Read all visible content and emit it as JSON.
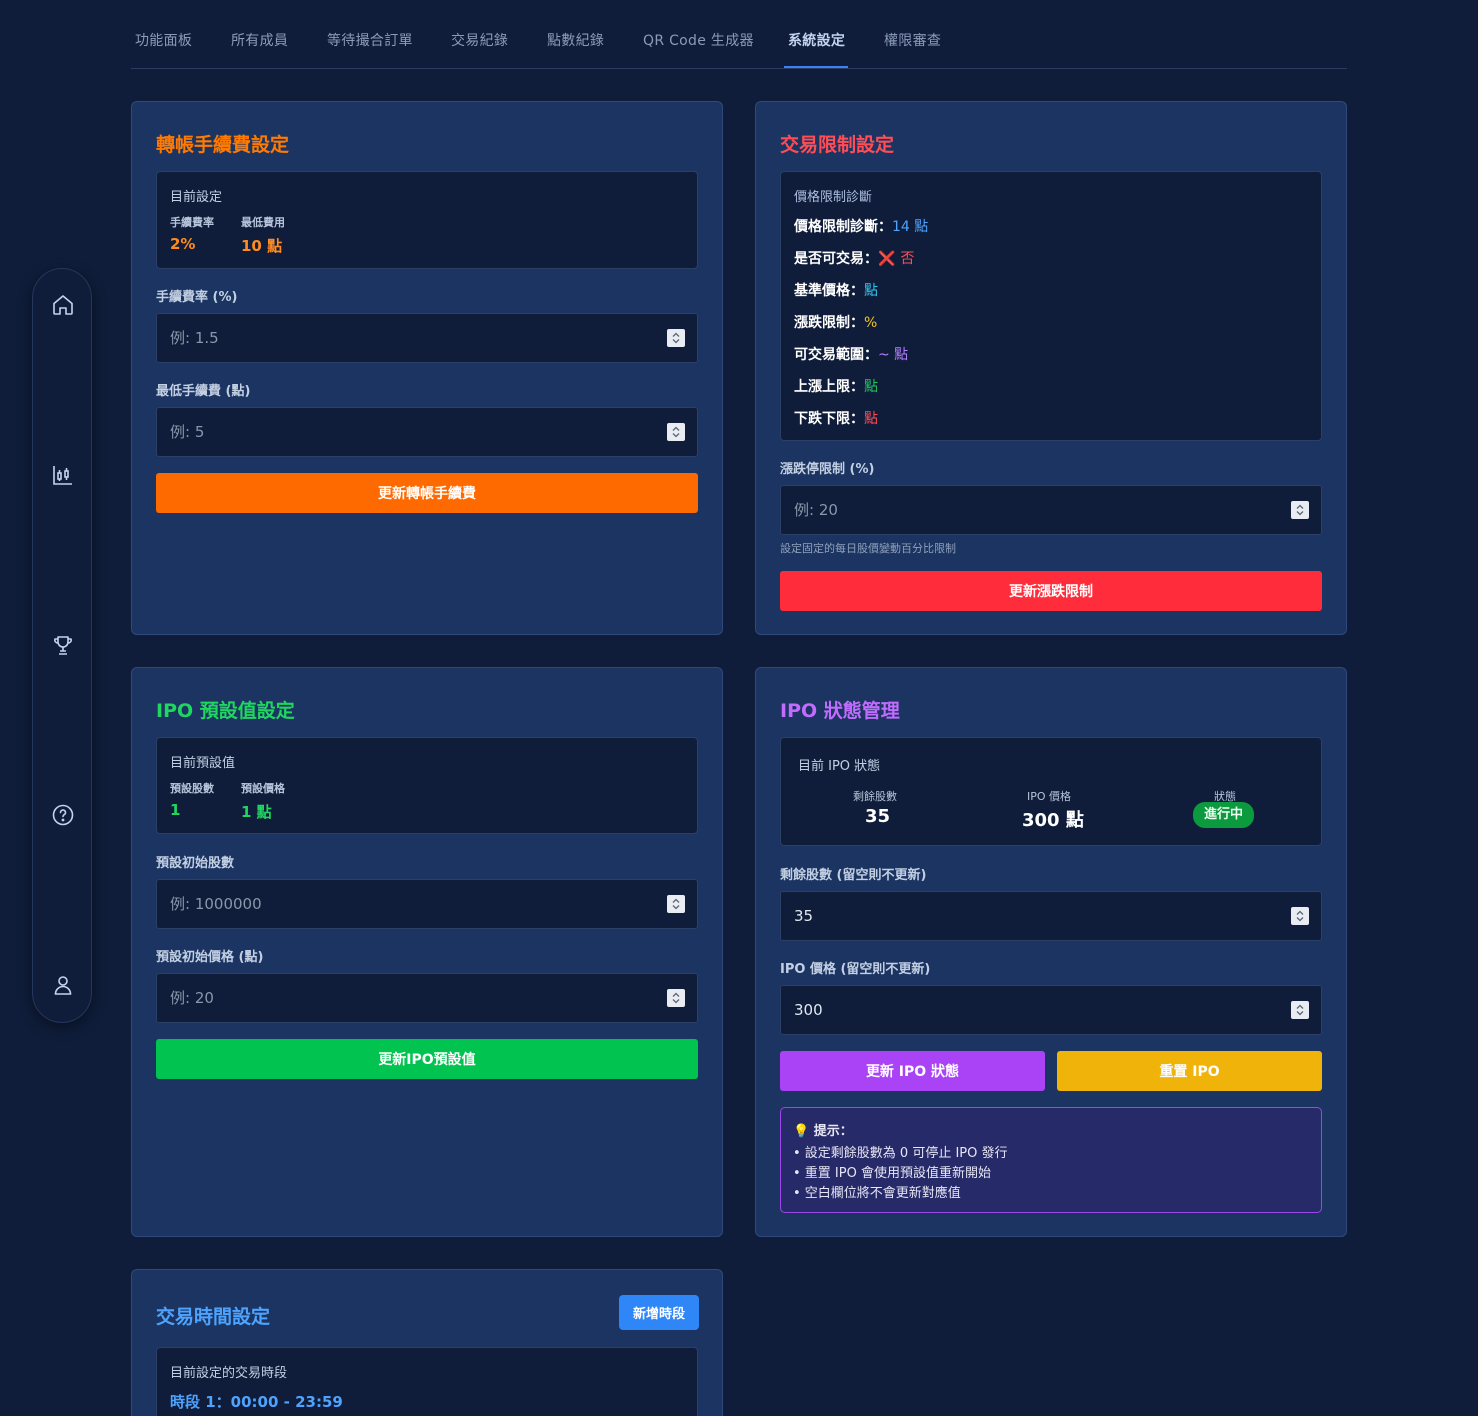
{
  "nav": {
    "tabs": [
      {
        "label": "功能面板"
      },
      {
        "label": "所有成員"
      },
      {
        "label": "等待撮合訂單"
      },
      {
        "label": "交易紀錄"
      },
      {
        "label": "點數紀錄"
      },
      {
        "label": "QR Code 生成器"
      },
      {
        "label": "系統設定"
      },
      {
        "label": "權限審查"
      }
    ],
    "active_tab": "系統設定"
  },
  "sidebar": {
    "icons": [
      "home-icon",
      "chart-icon",
      "trophy-icon",
      "help-icon",
      "user-icon"
    ]
  },
  "colors": {
    "accent_blue": "#3b82f6",
    "fee_orange": "#ff6a00",
    "limit_red": "#ff2d3b",
    "ipo_green": "#00c44f",
    "ipo_purple": "#a943f5",
    "reset_yellow": "#efb30a"
  },
  "fee": {
    "title": "轉帳手續費設定",
    "current_label": "目前設定",
    "rate_label": "手續費率",
    "rate_value": "2%",
    "min_label": "最低費用",
    "min_value": "10 點",
    "rate_field_label": "手續費率 (%)",
    "rate_placeholder": "例: 1.5",
    "min_field_label": "最低手續費 (點)",
    "min_placeholder": "例: 5",
    "button": "更新轉帳手續費"
  },
  "limit": {
    "title": "交易限制設定",
    "diag_title": "價格限制診斷",
    "rows": [
      {
        "label": "價格限制診斷：",
        "value": "14 點"
      },
      {
        "label": "是否可交易：",
        "value": "否"
      },
      {
        "label": "基準價格：",
        "value": "點"
      },
      {
        "label": "漲跌限制：",
        "value": "%"
      },
      {
        "label": "可交易範圍：",
        "value": "~ 點"
      },
      {
        "label": "上漲上限：",
        "value": "點"
      },
      {
        "label": "下跌下限：",
        "value": "點"
      }
    ],
    "field_label": "漲跌停限制 (%)",
    "placeholder": "例: 20",
    "helper": "設定固定的每日股價變動百分比限制",
    "button": "更新漲跌限制"
  },
  "ipo_defaults": {
    "title": "IPO 預設值設定",
    "current_label": "目前預設值",
    "shares_label": "預設股數",
    "shares_value": "1",
    "price_label": "預設價格",
    "price_value": "1 點",
    "shares_field_label": "預設初始股數",
    "shares_placeholder": "例: 1000000",
    "price_field_label": "預設初始價格 (點)",
    "price_placeholder": "例: 20",
    "button": "更新IPO預設值"
  },
  "ipo_status": {
    "title": "IPO 狀態管理",
    "current_label": "目前 IPO 狀態",
    "remaining_label": "剩餘股數",
    "remaining_value": "35",
    "price_label": "IPO 價格",
    "price_value": "300 點",
    "state_label": "狀態",
    "state_value": "進行中",
    "remaining_field_label": "剩餘股數 (留空則不更新)",
    "remaining_input": "35",
    "price_field_label": "IPO 價格 (留空則不更新)",
    "price_input": "300",
    "update_button": "更新 IPO 狀態",
    "reset_button": "重置 IPO",
    "hint_title": "提示：",
    "hint_lines": [
      "• 設定剩餘股數為 0 可停止 IPO 發行",
      "• 重置 IPO 會使用預設值重新開始",
      "• 空白欄位將不會更新對應值"
    ]
  },
  "trading_time": {
    "title": "交易時間設定",
    "add_button": "新增時段",
    "current_label": "目前設定的交易時段",
    "slot": "時段 1：00:00 - 23:59"
  }
}
